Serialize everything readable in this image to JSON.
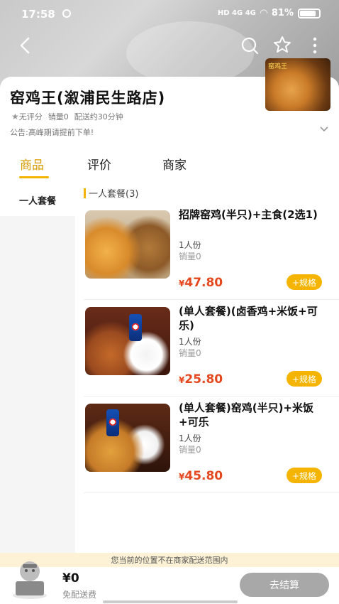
{
  "status_bar": {
    "time": "17:58",
    "network": "HD 4G 4G",
    "battery": "81%"
  },
  "shop": {
    "title": "窑鸡王(溆浦民生路店)",
    "rating": "无评分",
    "sales": "销量0",
    "delivery": "配送约30分钟",
    "notice": "公告:高峰期请提前下单!",
    "thumb_tag": "窑鸡王"
  },
  "tabs": [
    {
      "label": "商品",
      "active": true
    },
    {
      "label": "评价",
      "active": false
    },
    {
      "label": "商家",
      "active": false
    }
  ],
  "sidebar": {
    "items": [
      {
        "label": "一人套餐"
      }
    ]
  },
  "category": {
    "title": "一人套餐(3)"
  },
  "items": [
    {
      "name": "招牌窑鸡(半只)+主食(2选1)",
      "portion": "1人份",
      "sales": "销量0",
      "price": "47.80",
      "spec": "+规格"
    },
    {
      "name": "(单人套餐)(卤香鸡+米饭+可乐)",
      "portion": "1人份",
      "sales": "销量0",
      "price": "25.80",
      "spec": "+规格"
    },
    {
      "name": "(单人套餐)窑鸡(半只)+米饭+可乐",
      "portion": "1人份",
      "sales": "销量0",
      "price": "45.80",
      "spec": "+规格"
    }
  ],
  "currency": "¥",
  "cart": {
    "out_of_range": "您当前的位置不在商家配送范围内",
    "total": "¥0",
    "free_delivery": "免配送费",
    "checkout": "去结算"
  },
  "colors": {
    "accent": "#f5b400",
    "price": "#e5481f",
    "checkout_disabled": "#a8a8a8"
  }
}
